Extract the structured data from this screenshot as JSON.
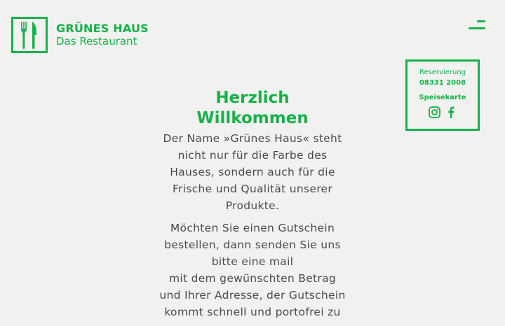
{
  "header": {
    "logo_name": "GRÜNES HAUS",
    "logo_sub": "Das Restaurant",
    "menu_icon": "hamburger-menu-icon"
  },
  "info_box": {
    "reservation_label": "Reservierung",
    "phone": "08331 2008",
    "menu_link": "Speisekarte",
    "social_icons": [
      "instagram-icon",
      "facebook-icon"
    ]
  },
  "main": {
    "title_line1": "Herzlich",
    "title_line2": "Willkommen",
    "para1": [
      "Der Name »Grünes Haus« steht",
      "nicht nur für die Farbe des",
      "Hauses, sondern auch für die",
      "Frische und Qualität unserer",
      "Produkte."
    ],
    "para2": [
      "Möchten Sie einen Gutschein",
      "bestellen, dann senden Sie uns",
      "bitte eine mail",
      "mit dem gewünschten Betrag",
      "und Ihrer Adresse, der Gutschein",
      "kommt schnell und portofrei zu"
    ]
  },
  "colors": {
    "accent": "#17b14a",
    "background": "#f1f1ef",
    "text": "#4a4a4a"
  }
}
